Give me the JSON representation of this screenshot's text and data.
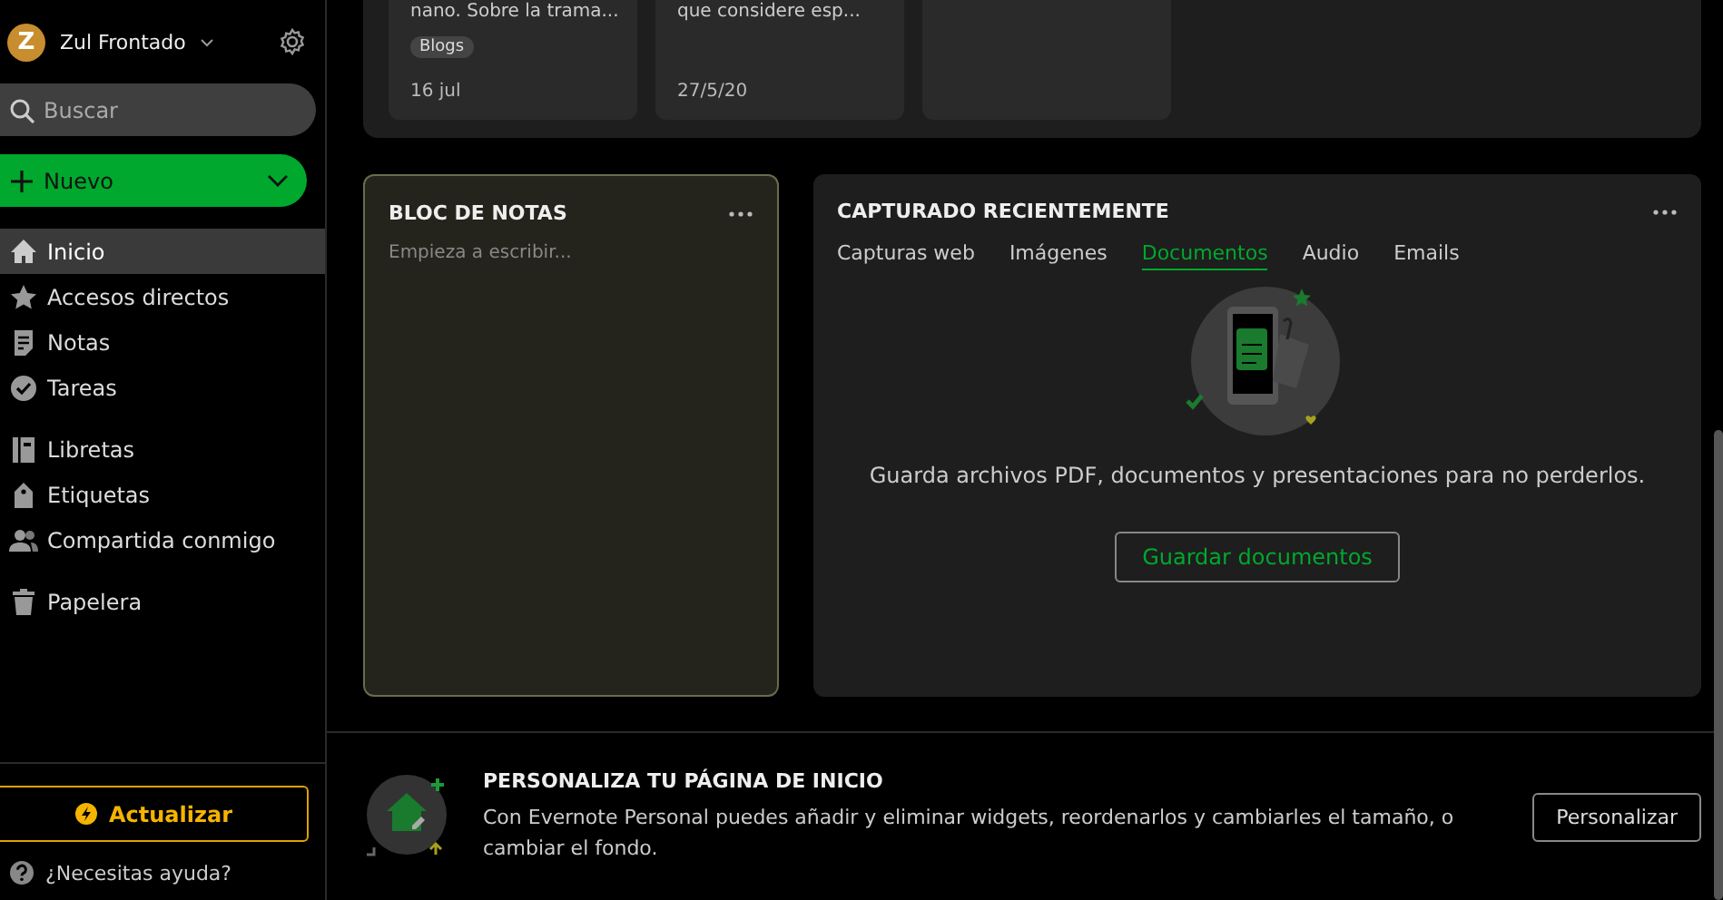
{
  "account": {
    "initial": "Z",
    "name": "Zul Frontado"
  },
  "search": {
    "placeholder": "Buscar"
  },
  "new_button": {
    "label": "Nuevo"
  },
  "nav_groups": [
    [
      {
        "label": "Inicio",
        "kind": "home",
        "selected": true
      },
      {
        "label": "Accesos directos",
        "kind": "star",
        "selected": false
      },
      {
        "label": "Notas",
        "kind": "note",
        "selected": false
      },
      {
        "label": "Tareas",
        "kind": "task",
        "selected": false
      }
    ],
    [
      {
        "label": "Libretas",
        "kind": "notebook",
        "selected": false
      },
      {
        "label": "Etiquetas",
        "kind": "tag",
        "selected": false
      },
      {
        "label": "Compartida conmigo",
        "kind": "people",
        "selected": false
      }
    ],
    [
      {
        "label": "Papelera",
        "kind": "trash",
        "selected": false
      }
    ]
  ],
  "upgrade_button": {
    "label": "Actualizar"
  },
  "help": {
    "label": "¿Necesitas ayuda?"
  },
  "recent_notes": [
    {
      "kind": "note",
      "snippet": "nano. Sobre la trama...",
      "tag": "Blogs",
      "date": "16 jul"
    },
    {
      "kind": "note",
      "snippet": "que considere esp...",
      "date": "27/5/20"
    },
    {
      "kind": "empty"
    }
  ],
  "scratch_pad": {
    "title": "BLOC DE NOTAS",
    "placeholder": "Empieza a escribir..."
  },
  "recently_captured": {
    "title": "CAPTURADO RECIENTEMENTE",
    "tabs": [
      {
        "label": "Capturas web",
        "selected": false
      },
      {
        "label": "Imágenes",
        "selected": false
      },
      {
        "label": "Documentos",
        "selected": true
      },
      {
        "label": "Audio",
        "selected": false
      },
      {
        "label": "Emails",
        "selected": false
      }
    ],
    "message": "Guarda archivos PDF, documentos y presentaciones para no perderlos.",
    "button": "Guardar documentos"
  },
  "banner": {
    "title": "PERSONALIZA TU PÁGINA DE INICIO",
    "text": "Con Evernote Personal puedes añadir y eliminar widgets, reordenarlos y cambiarles el tamaño, o cambiar el fondo.",
    "button": "Personalizar"
  }
}
